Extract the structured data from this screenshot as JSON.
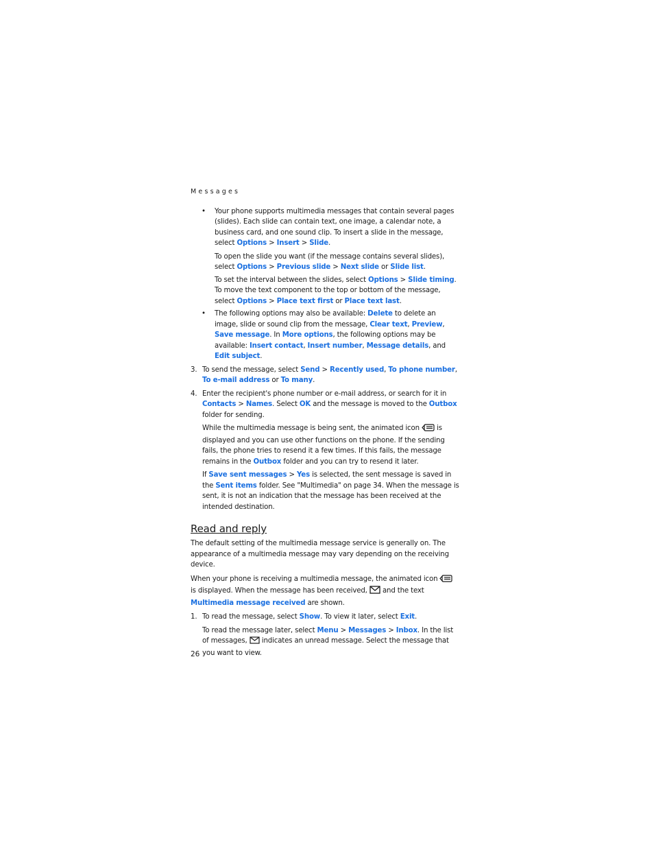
{
  "header": {
    "running_head": "Messages"
  },
  "bullets": [
    {
      "p1": [
        "Your phone supports multimedia messages that contain several pages (slides). Each slide can contain text, one image, a calendar note, a business card, and one sound clip. To insert a slide in the message, select ",
        "Options",
        " > ",
        "Insert",
        " > ",
        "Slide",
        "."
      ],
      "p2": [
        "To open the slide you want (if the message contains several slides), select ",
        "Options",
        " > ",
        "Previous slide",
        " > ",
        "Next slide",
        " or ",
        "Slide list",
        "."
      ],
      "p3": [
        "To set the interval between the slides, select ",
        "Options",
        " > ",
        "Slide timing",
        ". To move the text component to the top or bottom of the message, select ",
        "Options",
        " > ",
        "Place text first",
        " or ",
        "Place text last",
        "."
      ]
    },
    {
      "p1": [
        "The following options may also be available: ",
        "Delete",
        " to delete an image, slide or sound clip from the message, ",
        "Clear text",
        ", ",
        "Preview",
        ", ",
        "Save message",
        ". In ",
        "More options",
        ", the following options may be available: ",
        "Insert contact",
        ", ",
        "Insert number",
        ", ",
        "Message details",
        ", and ",
        "Edit subject",
        "."
      ]
    }
  ],
  "step3": {
    "number": "3.",
    "text": [
      "To send the message, select ",
      "Send",
      " > ",
      "Recently used",
      ", ",
      "To phone number",
      ", ",
      "To e-mail address",
      " or ",
      "To many",
      "."
    ]
  },
  "step4": {
    "number": "4.",
    "p1": [
      "Enter the recipient's phone number or e-mail address, or search for it in ",
      "Contacts",
      " > ",
      "Names",
      ". Select ",
      "OK",
      " and the message is moved to the ",
      "Outbox",
      " folder for sending."
    ],
    "p2a": "While the multimedia message is being sent, the animated icon ",
    "p2b": " is displayed and you can use other functions on the phone. If the sending fails, the phone tries to resend it a few times. If this fails, the message remains in the ",
    "p2c": "Outbox",
    "p2d": " folder and you can try to resend it later.",
    "p3": [
      "If ",
      "Save sent messages",
      " > ",
      "Yes",
      " is selected, the sent message is saved in the ",
      "Sent items",
      " folder. See \"Multimedia\" on page 34. When the message is sent, it is not an indication that the message has been received at the intended destination."
    ]
  },
  "section": {
    "title": "Read and reply",
    "intro": "The default setting of the multimedia message service is generally on. The appearance of a multimedia message may vary depending on the receiving device.",
    "p2a": "When your phone is receiving a multimedia message, the animated icon ",
    "p2b": " is displayed. When the message has been received, ",
    "p2c": " and the text ",
    "p2d": "Multimedia message received",
    "p2e": " are shown.",
    "step1": {
      "number": "1.",
      "text": [
        "To read the message, select ",
        "Show",
        ". To view it later, select ",
        "Exit",
        "."
      ],
      "p2": [
        "To read the message later, select ",
        "Menu",
        " > ",
        "Messages",
        " > ",
        "Inbox",
        ". In the list of messages, "
      ],
      "p2_tail": " indicates an unread message. Select the message that you want to view."
    }
  },
  "icons": {
    "sending": "mms-sending-icon",
    "received": "envelope-icon",
    "unread": "envelope-icon"
  },
  "footer": {
    "page_number": "26"
  },
  "colors": {
    "link": "#1a6fe0",
    "text": "#1a1a1a"
  }
}
